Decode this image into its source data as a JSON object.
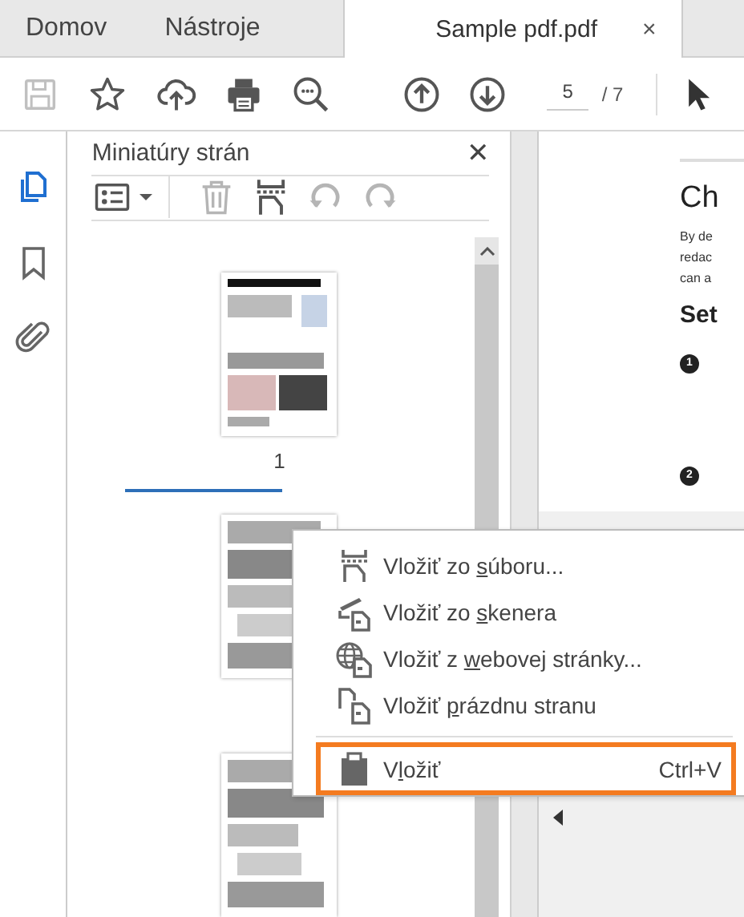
{
  "tabs": [
    {
      "label": "Domov",
      "selected": false
    },
    {
      "label": "Nástroje",
      "selected": false
    },
    {
      "label": "Sample pdf.pdf",
      "selected": true,
      "close": "×"
    }
  ],
  "toolbar": {
    "buttons": [
      {
        "kind": "save",
        "disabled": true
      },
      {
        "kind": "star",
        "disabled": false
      },
      {
        "kind": "upload",
        "disabled": false
      },
      {
        "kind": "print",
        "disabled": false
      },
      {
        "kind": "zoom",
        "disabled": false
      },
      {
        "kind": "up",
        "disabled": false
      },
      {
        "kind": "down",
        "disabled": false
      }
    ],
    "page_number": "5",
    "page_total": "/ 7",
    "tool": {
      "kind": "pointer"
    }
  },
  "side_rail": [
    {
      "kind": "pages",
      "selected": true
    },
    {
      "kind": "bookmark",
      "selected": false
    },
    {
      "kind": "attachment",
      "selected": false
    }
  ],
  "panel": {
    "title": "Miniatúry strán",
    "close": "✕",
    "tools": [
      {
        "kind": "options",
        "disabled": false
      },
      {
        "kind": "delete",
        "disabled": true
      },
      {
        "kind": "insert",
        "disabled": false
      },
      {
        "kind": "undo",
        "disabled": true
      },
      {
        "kind": "redo",
        "disabled": true
      }
    ],
    "thumbnails": [
      {
        "kind": "picture",
        "label": "1"
      },
      {
        "kind": "picture"
      },
      {
        "kind": "picture"
      }
    ]
  },
  "document": {
    "heading": "Ch",
    "lines": [
      "By de",
      "redac",
      "can a"
    ],
    "subheading": "Set",
    "steps": [
      "1",
      "2"
    ]
  },
  "context_menu": [
    {
      "kind": "file",
      "before": "Vložiť zo ",
      "key": "s",
      "after": "úboru...",
      "highlighted": false,
      "separator_before": false
    },
    {
      "kind": "scanner",
      "before": "Vložiť zo ",
      "key": "s",
      "after": "kenera",
      "highlighted": false,
      "separator_before": false
    },
    {
      "kind": "web",
      "before": "Vložiť z ",
      "key": "w",
      "after": "ebovej stránky...",
      "highlighted": false,
      "separator_before": false
    },
    {
      "kind": "blank",
      "before": "Vložiť ",
      "key": "p",
      "after": "rázdnu stranu",
      "highlighted": false,
      "separator_before": false
    },
    {
      "kind": "paste",
      "before": "V",
      "key": "l",
      "after": "ožiť",
      "shortcut": "Ctrl+V",
      "highlighted": true,
      "separator_before": true
    }
  ]
}
